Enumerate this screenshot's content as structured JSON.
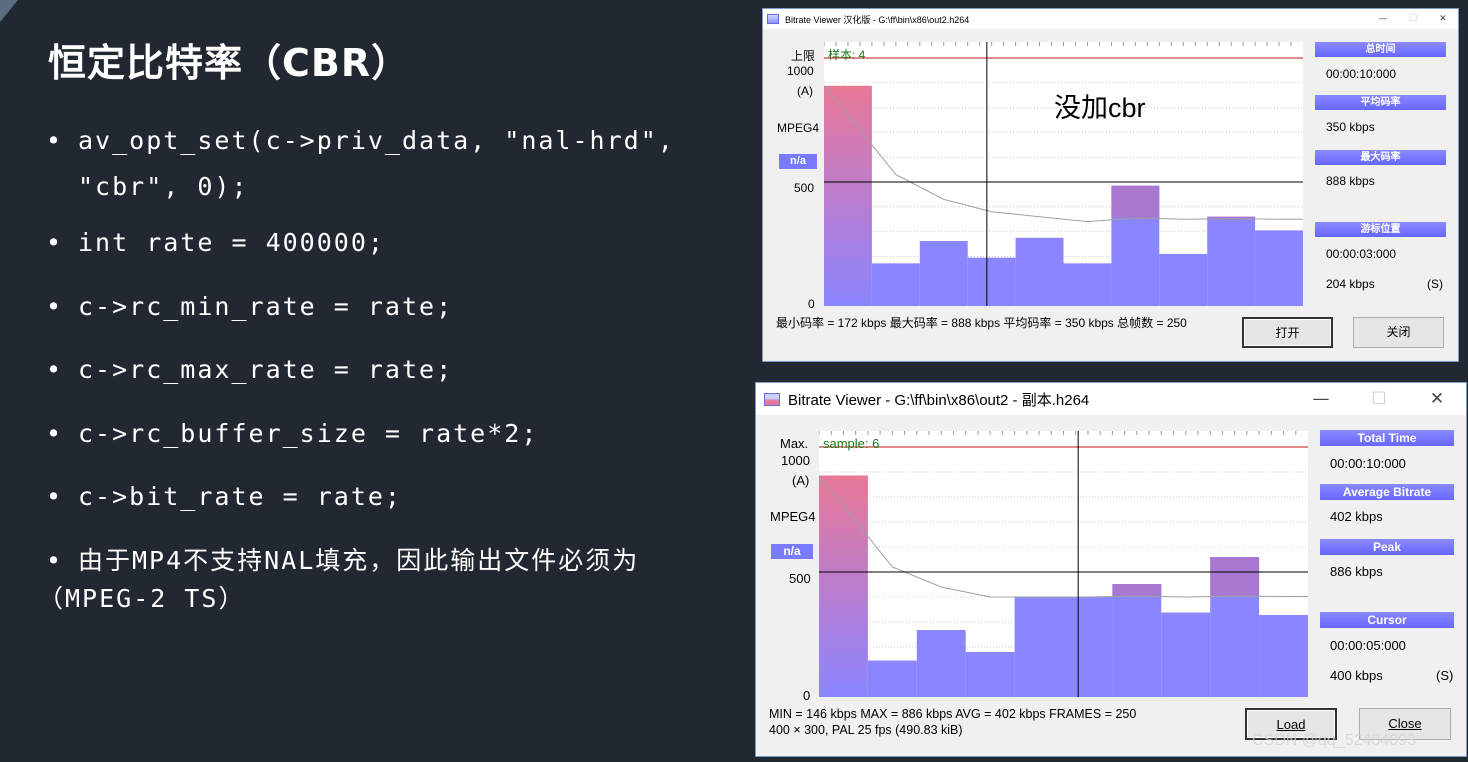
{
  "slide": {
    "title": "恒定比特率（CBR）",
    "bullets": [
      {
        "line1": "av_opt_set(c->priv_data, \"nal-hrd\",",
        "line2": "\"cbr\", 0);"
      },
      {
        "text": "int rate = 400000;"
      },
      {
        "text": "c->rc_min_rate = rate;"
      },
      {
        "text": "c->rc_max_rate = rate;"
      },
      {
        "text": "c->rc_buffer_size = rate*2;"
      },
      {
        "text": "c->bit_rate = rate;"
      },
      {
        "line1": "由于MP4不支持NAL填充，因此输出文件必须为",
        "line2": "（MPEG-2 TS）"
      }
    ],
    "bullet_glyph": "•",
    "watermark": "CSDN @qq_52484093"
  },
  "window1": {
    "title": "Bitrate Viewer 汉化版 - G:\\ff\\bin\\x86\\out2.h264",
    "overlay_note": "没加cbr",
    "max_label": "上限",
    "sample_label": "样本: 4",
    "y_top": "1000",
    "y_mid": "500",
    "y_zero": "0",
    "a_label": "(A)",
    "codec": "MPEG4",
    "na": "n/a",
    "total_time_label": "总时间",
    "total_time": "00:00:10:000",
    "avg_label": "平均码率",
    "avg": "350 kbps",
    "peak_label": "最大码率",
    "peak": "888 kbps",
    "cursor_label": "游标位置",
    "cursor_time": "00:00:03:000",
    "cursor_rate": "204 kbps",
    "s_label": "(S)",
    "stats_line": "最小码率 = 172 kbps  最大码率 = 888 kbps  平均码率 = 350 kbps  总帧数 = 250",
    "open_btn": "打开",
    "close_btn": "关闭",
    "controls": {
      "min": "—",
      "max": "☐",
      "close": "✕"
    }
  },
  "window2": {
    "title": "Bitrate Viewer - G:\\ff\\bin\\x86\\out2 - 副本.h264",
    "max_label": "Max.",
    "sample_label": "sample: 6",
    "y_top": "1000",
    "y_mid": "500",
    "y_zero": "0",
    "a_label": "(A)",
    "codec": "MPEG4",
    "na": "n/a",
    "total_time_label": "Total Time",
    "total_time": "00:00:10:000",
    "avg_label": "Average Bitrate",
    "avg": "402 kbps",
    "peak_label": "Peak",
    "peak": "886 kbps",
    "cursor_label": "Cursor",
    "cursor_time": "00:00:05:000",
    "cursor_rate": "400 kbps",
    "s_label": "(S)",
    "stats_line1": "MIN = 146 kbps  MAX = 886 kbps  AVG = 402 kbps  FRAMES = 250",
    "stats_line2": "400 × 300, PAL 25 fps    (490.83 kiB)",
    "load_btn": "Load",
    "close_btn": "Close",
    "controls": {
      "min": "—",
      "max": "☐",
      "close": "✕"
    }
  },
  "chart_data": [
    {
      "type": "bar",
      "x": [
        0,
        1,
        2,
        3,
        4,
        5,
        6,
        7,
        8,
        9
      ],
      "values": [
        888,
        172,
        262,
        195,
        275,
        172,
        485,
        210,
        360,
        305
      ],
      "series": [
        {
          "values": [
            888,
            172,
            262,
            195,
            275,
            172,
            485,
            210,
            360,
            305
          ]
        },
        {
          "values": [
            888,
            530,
            430,
            380,
            360,
            340,
            355,
            350,
            352,
            350
          ]
        }
      ],
      "ylim": [
        0,
        1000
      ],
      "max_line": 1000,
      "cursor_x": 3.4,
      "colors": {
        "bar": "#8a86ff",
        "bar_red": "#e87896",
        "bar_purple": "#a878d0",
        "avg_line": "#a0a0a0",
        "max_line": "#d04040"
      }
    },
    {
      "type": "bar",
      "x": [
        0,
        1,
        2,
        3,
        4,
        5,
        6,
        7,
        8,
        9
      ],
      "values": [
        886,
        146,
        268,
        180,
        400,
        400,
        452,
        338,
        560,
        328
      ],
      "series": [
        {
          "values": [
            886,
            146,
            268,
            180,
            400,
            400,
            452,
            338,
            560,
            328
          ]
        },
        {
          "values": [
            886,
            520,
            440,
            400,
            400,
            400,
            404,
            400,
            404,
            402
          ]
        }
      ],
      "ylim": [
        0,
        1000
      ],
      "max_line": 1000,
      "cursor_x": 5.3,
      "colors": {
        "bar": "#8a86ff",
        "bar_red": "#e87896",
        "bar_purple": "#a878d0",
        "avg_line": "#a0a0a0",
        "max_line": "#d04040"
      }
    }
  ]
}
